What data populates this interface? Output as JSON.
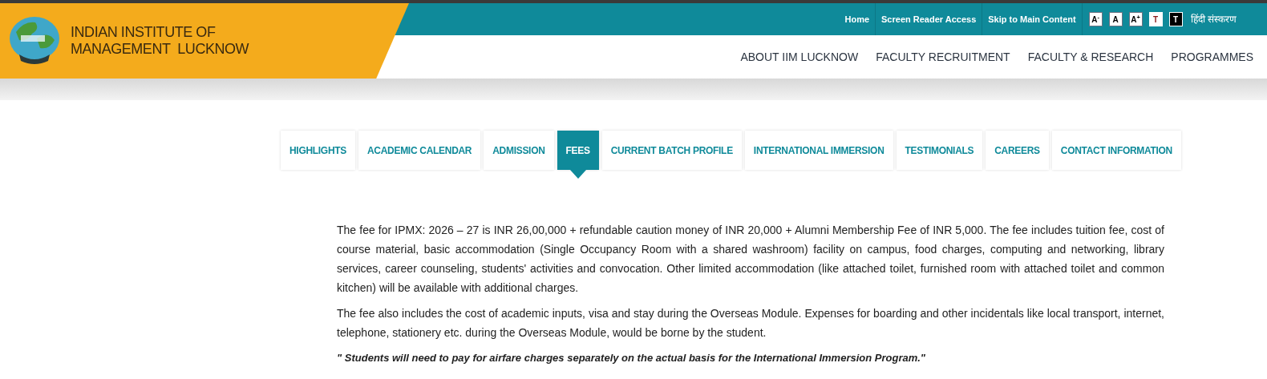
{
  "logo": {
    "name_lines": [
      "INDIAN INSTITUTE OF",
      "MANAGEMENT  LUCKNOW"
    ]
  },
  "top_links": [
    "Home",
    "Screen Reader Access",
    "Skip to Main Content"
  ],
  "text_controls": [
    {
      "label": "A$^{-}$",
      "kind": "size"
    },
    {
      "label": "A",
      "kind": "size"
    },
    {
      "label": "A$^{+}$",
      "kind": "size"
    },
    {
      "label": "T",
      "kind": "light"
    },
    {
      "label": "T",
      "kind": "dark"
    }
  ],
  "language_link": "हिंदी संस्करण",
  "main_nav": [
    "ABOUT IIM LUCKNOW",
    "FACULTY RECRUITMENT",
    "FACULTY & RESEARCH",
    "PROGRAMMES"
  ],
  "tabs": [
    {
      "label": "HIGHLIGHTS",
      "selected": false
    },
    {
      "label": "ACADEMIC CALENDAR",
      "selected": false
    },
    {
      "label": "ADMISSION",
      "selected": false
    },
    {
      "label": "FEES",
      "selected": true
    },
    {
      "label": "CURRENT BATCH PROFILE",
      "selected": false
    },
    {
      "label": "INTERNATIONAL IMMERSION",
      "selected": false
    },
    {
      "label": "TESTIMONIALS",
      "selected": false
    },
    {
      "label": "CAREERS",
      "selected": false
    },
    {
      "label": "CONTACT INFORMATION",
      "selected": false
    }
  ],
  "content": [
    {
      "kind": "paragraph",
      "text": "The fee for IPMX: 2026 – 27 is INR 26,00,000 + refundable caution money of INR 20,000 + Alumni Membership Fee of INR 5,000. The fee includes tuition fee, cost of course material, basic accommodation (Single Occupancy Room with a shared washroom) facility on campus, food charges, computing and networking, library services, career counseling, students' activities and convocation. Other limited accommodation (like attached toilet, furnished room with attached toilet and common kitchen) will be available with additional charges."
    },
    {
      "kind": "paragraph",
      "text": "The fee also includes the cost of academic inputs, visa and stay during the Overseas Module. Expenses for boarding and other incidentals like local transport, internet, telephone, stationery etc. during the Overseas Module, would be borne by the student."
    },
    {
      "kind": "note",
      "text": "\" Students will need to pay for airfare charges separately on the actual basis for the International Immersion Program.\""
    }
  ]
}
